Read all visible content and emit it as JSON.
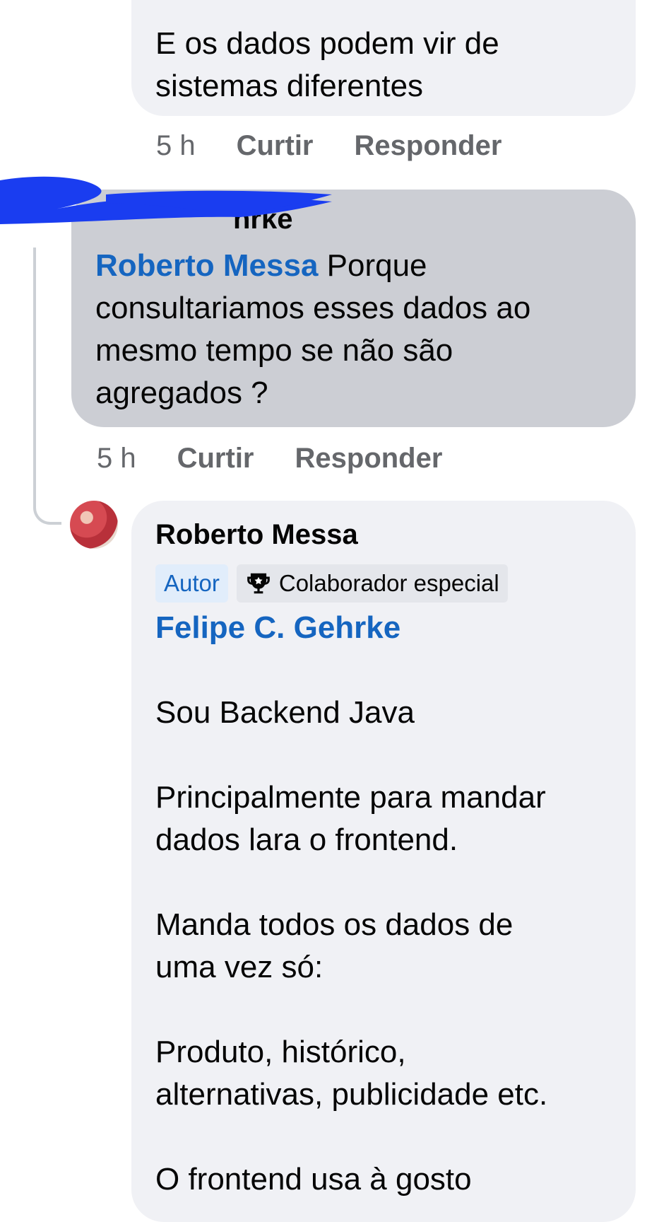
{
  "comment1": {
    "text_line1": "E os dados podem vir de",
    "text_line2": "sistemas diferentes",
    "time": "5 h",
    "like_label": "Curtir",
    "reply_label": "Responder"
  },
  "comment2": {
    "obscured_name_fragment": "hrke",
    "mention": "Roberto Messa",
    "text_first": " Porque",
    "text_line2": "consultariamos esses dados ao",
    "text_line3": "mesmo tempo se não são",
    "text_line4": "agregados ?",
    "time": "5 h",
    "like_label": "Curtir",
    "reply_label": "Responder"
  },
  "comment3": {
    "author": "Roberto Messa",
    "badge_author": "Autor",
    "badge_contributor": "Colaborador especial",
    "badge_icon": "trophy-icon",
    "mention": "Felipe C. Gehrke",
    "p1": "Sou Backend Java",
    "p2_line1": "Principalmente para mandar",
    "p2_line2": "dados lara o frontend.",
    "p3_line1": "Manda todos os dados de",
    "p3_line2": "uma vez só:",
    "p4_line1": "Produto, histórico,",
    "p4_line2": "alternativas, publicidade etc.",
    "p5": "O frontend usa à gosto"
  },
  "colors": {
    "link_blue": "#1565c0",
    "bubble_bg": "#f0f1f5",
    "highlight_bubble_bg": "#ccced4",
    "meta_gray": "#65676b",
    "scribble_blue": "#1a3df0"
  }
}
